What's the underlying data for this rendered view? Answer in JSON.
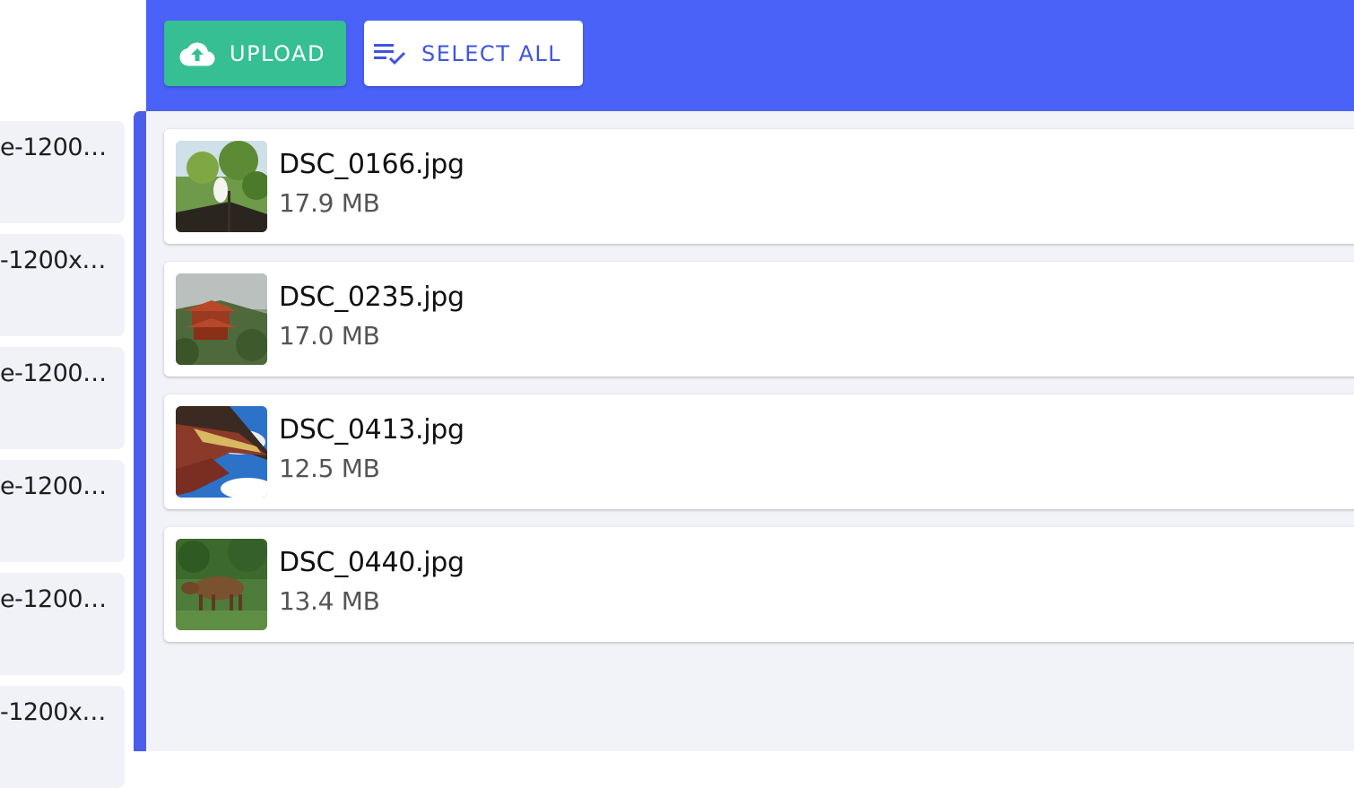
{
  "sidebar": {
    "items": [
      {
        "label": "e-1200…"
      },
      {
        "label": "-1200x…"
      },
      {
        "label": "e-1200…"
      },
      {
        "label": "e-1200…"
      },
      {
        "label": "e-1200…"
      },
      {
        "label": "-1200x…"
      }
    ]
  },
  "toolbar": {
    "upload_label": "UPLOAD",
    "upload_icon": "cloud-upload-icon",
    "select_all_label": "SELECT ALL",
    "select_all_icon": "checklist-icon"
  },
  "files": [
    {
      "name": "DSC_0166.jpg",
      "size": "17.9 MB"
    },
    {
      "name": "DSC_0235.jpg",
      "size": "17.0 MB"
    },
    {
      "name": "DSC_0413.jpg",
      "size": "12.5 MB"
    },
    {
      "name": "DSC_0440.jpg",
      "size": "13.4 MB"
    }
  ],
  "colors": {
    "topbar": "#4a62f7",
    "upload_button": "#36bf93",
    "accent_text": "#3f55e0",
    "background": "#f2f3f8"
  }
}
